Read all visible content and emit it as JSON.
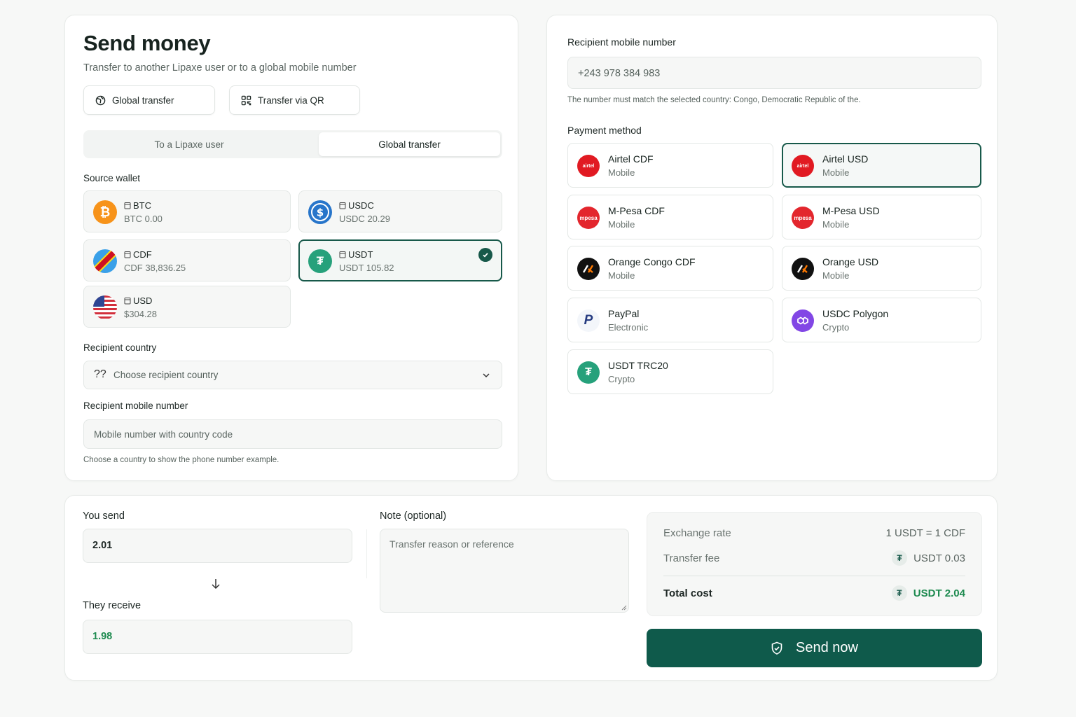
{
  "header": {
    "title": "Send money",
    "subtitle": "Transfer to another Lipaxe user or to a global mobile number"
  },
  "mode_buttons": {
    "global": "Global transfer",
    "qr": "Transfer via QR"
  },
  "tabs": {
    "lipaxe": "To a Lipaxe user",
    "global": "Global transfer",
    "active": "global"
  },
  "source_wallet": {
    "label": "Source wallet",
    "wallets": [
      {
        "name": "BTC",
        "balance": "BTC 0.00",
        "icon": "bitcoin-icon",
        "selected": false
      },
      {
        "name": "USDC",
        "balance": "USDC 20.29",
        "icon": "usdc-icon",
        "selected": false
      },
      {
        "name": "CDF",
        "balance": "CDF 38,836.25",
        "icon": "congo-flag-icon",
        "selected": false
      },
      {
        "name": "USDT",
        "balance": "USDT 105.82",
        "icon": "tether-icon",
        "selected": true
      },
      {
        "name": "USD",
        "balance": "$304.28",
        "icon": "us-flag-icon",
        "selected": false
      }
    ]
  },
  "recipient_country": {
    "label": "Recipient country",
    "flag_placeholder": "??",
    "placeholder": "Choose recipient country"
  },
  "recipient_mobile_left": {
    "label": "Recipient mobile number",
    "placeholder": "Mobile number with country code",
    "hint": "Choose a country to show the phone number example."
  },
  "recipient_mobile_right": {
    "label": "Recipient mobile number",
    "value": "+243 978 384 983",
    "hint": "The number must match the selected country: Congo, Democratic Republic of the."
  },
  "payment_method": {
    "label": "Payment method",
    "methods": [
      {
        "name": "Airtel CDF",
        "type": "Mobile",
        "icon": "airtel-icon",
        "selected": false
      },
      {
        "name": "Airtel USD",
        "type": "Mobile",
        "icon": "airtel-icon",
        "selected": true
      },
      {
        "name": "M-Pesa CDF",
        "type": "Mobile",
        "icon": "mpesa-icon",
        "selected": false
      },
      {
        "name": "M-Pesa USD",
        "type": "Mobile",
        "icon": "mpesa-icon",
        "selected": false
      },
      {
        "name": "Orange Congo CDF",
        "type": "Mobile",
        "icon": "orange-icon",
        "selected": false
      },
      {
        "name": "Orange USD",
        "type": "Mobile",
        "icon": "orange-icon",
        "selected": false
      },
      {
        "name": "PayPal",
        "type": "Electronic",
        "icon": "paypal-icon",
        "selected": false
      },
      {
        "name": "USDC Polygon",
        "type": "Crypto",
        "icon": "polygon-icon",
        "selected": false
      },
      {
        "name": "USDT TRC20",
        "type": "Crypto",
        "icon": "tron-tether-icon",
        "selected": false
      }
    ]
  },
  "amount": {
    "send_label": "You send",
    "send_value": "2.01",
    "receive_label": "They receive",
    "receive_value": "1.98"
  },
  "note": {
    "label": "Note (optional)",
    "placeholder": "Transfer reason or reference"
  },
  "summary": {
    "rate_label": "Exchange rate",
    "rate_value": "1 USDT = 1 CDF",
    "fee_label": "Transfer fee",
    "fee_value": "USDT 0.03",
    "total_label": "Total cost",
    "total_value": "USDT 2.04",
    "currency_glyph": "₮"
  },
  "send_button": "Send now",
  "colors": {
    "primary": "#0f5a4b",
    "accent_green": "#1d8a4f"
  }
}
